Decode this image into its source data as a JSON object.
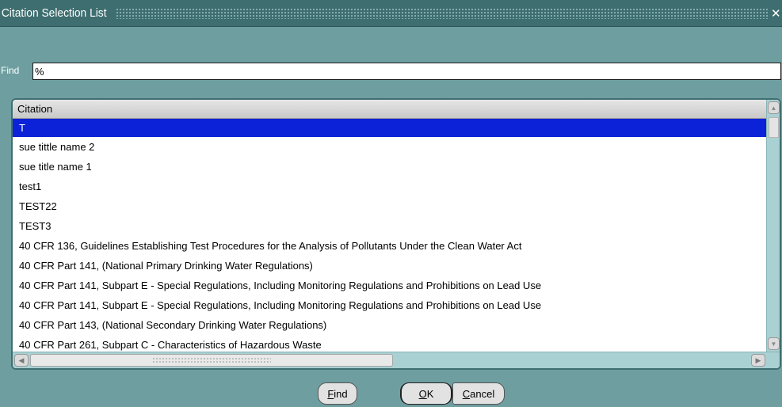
{
  "window": {
    "title": "Citation Selection List",
    "close_icon": "close-icon"
  },
  "find": {
    "label": "Find",
    "value": "%"
  },
  "list": {
    "column_header": "Citation",
    "rows": [
      "T",
      "sue tittle name 2",
      "sue title name 1",
      "test1",
      "TEST22",
      "TEST3",
      "40 CFR 136, Guidelines Establishing Test Procedures for the Analysis of Pollutants Under the Clean Water Act",
      "40 CFR Part 141, (National Primary Drinking Water Regulations)",
      "40 CFR Part 141, Subpart E - Special Regulations, Including Monitoring Regulations and Prohibitions on Lead Use",
      "40 CFR Part 141, Subpart E - Special Regulations, Including Monitoring Regulations and Prohibitions on Lead Use",
      "40 CFR Part 143,  (National Secondary Drinking Water Regulations)",
      "40 CFR Part 261, Subpart C - Characteristics of Hazardous Waste"
    ],
    "selected_index": 0
  },
  "buttons": {
    "find": {
      "first": "F",
      "rest": "ind"
    },
    "ok": {
      "first": "O",
      "rest": "K"
    },
    "cancel": {
      "first": "C",
      "rest": "ancel"
    }
  },
  "colors": {
    "background": "#6e9ea0",
    "titlebar": "#3e6e70",
    "selection": "#0c22d8"
  }
}
